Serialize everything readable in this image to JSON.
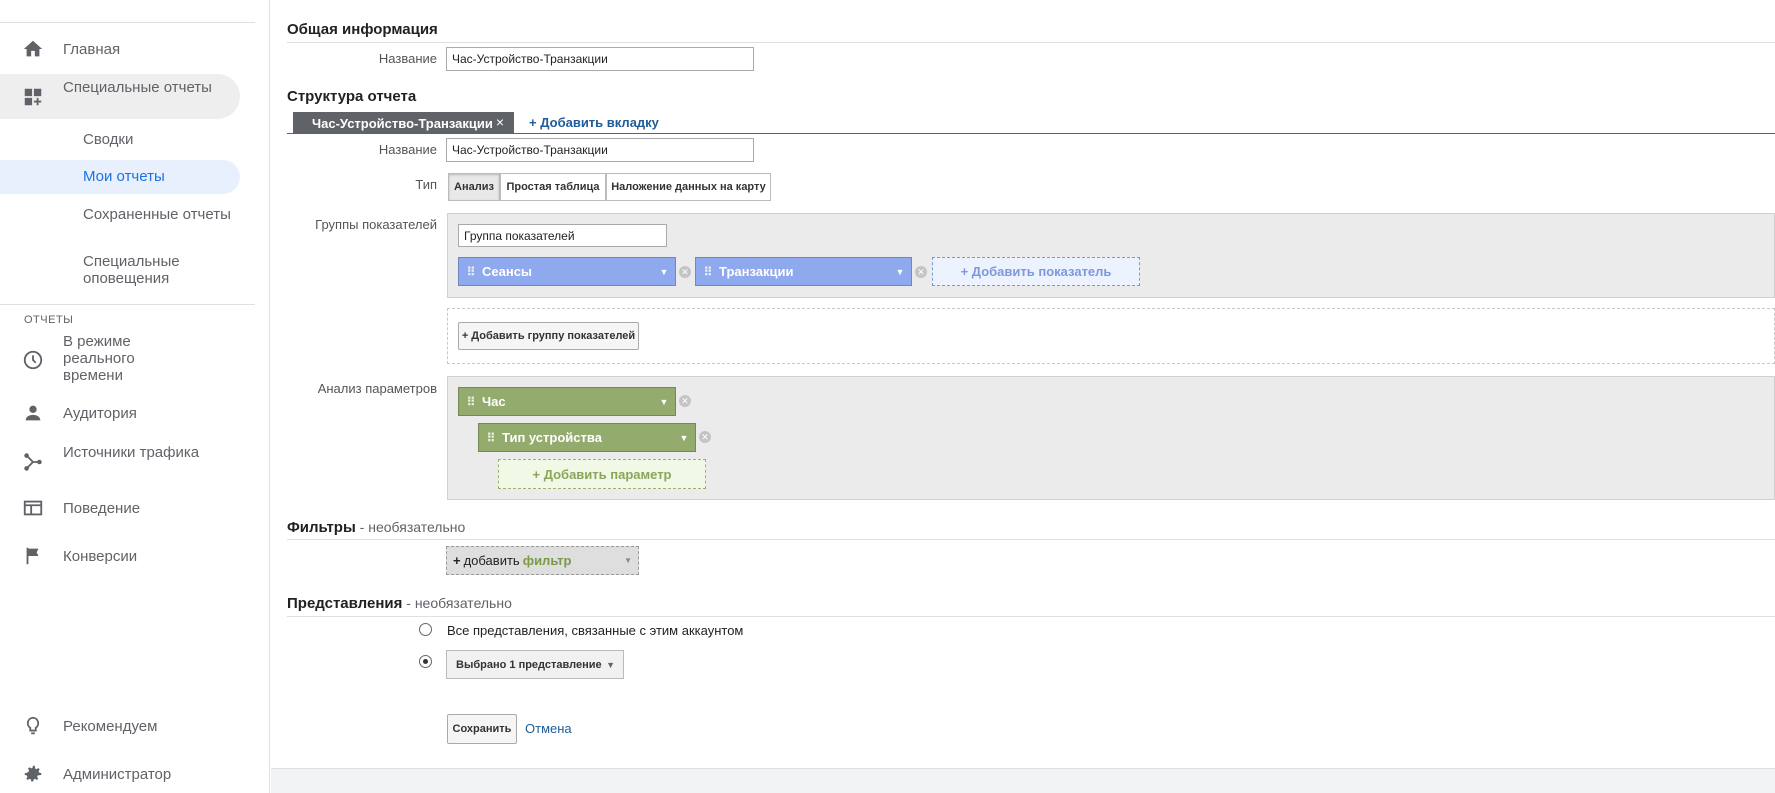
{
  "sidebar": {
    "home": "Главная",
    "custom_reports": "Специальные отчеты",
    "sub_items": [
      "Сводки",
      "Мои отчеты",
      "Сохраненные отчеты",
      "Специальные оповещения"
    ],
    "reports_section": "ОТЧЕТЫ",
    "realtime": "В режиме реального времени",
    "audience": "Аудитория",
    "acquisition": "Источники трафика",
    "behavior": "Поведение",
    "conversions": "Конверсии",
    "discover": "Рекомендуем",
    "admin": "Администратор"
  },
  "general": {
    "heading": "Общая информация",
    "name_label": "Название",
    "name_value": "Час-Устройство-Транзакции"
  },
  "structure": {
    "heading": "Структура отчета",
    "tab_label": "Час-Устройство-Транзакции",
    "tab_close": "×",
    "add_tab": "+ Добавить вкладку",
    "name_label": "Название",
    "name_value": "Час-Устройство-Транзакции",
    "type_label": "Тип",
    "types": [
      "Анализ",
      "Простая таблица",
      "Наложение данных на карту"
    ],
    "metric_groups_label": "Группы показателей",
    "metric_group_name": "Группа показателей",
    "metrics": [
      "Сеансы",
      "Транзакции"
    ],
    "add_metric": "+ Добавить показатель",
    "add_metric_group": "+ Добавить группу показателей",
    "dimension_drilldowns_label": "Анализ параметров",
    "dimensions": [
      "Час",
      "Тип устройства"
    ],
    "add_dimension": "+ Добавить параметр"
  },
  "filters": {
    "heading": "Фильтры",
    "optional": " - необязательно",
    "add_plus": "+",
    "add_word": "добавить",
    "add_filter": "фильтр"
  },
  "views": {
    "heading": "Представления",
    "optional": " - необязательно",
    "all_views": "Все представления, связанные с этим аккаунтом",
    "selected": "Выбрано 1 представление"
  },
  "actions": {
    "save": "Сохранить",
    "cancel": "Отмена"
  },
  "colors": {
    "metric_chip": "#8ea9ee",
    "dimension_chip": "#94ab6e",
    "link": "#1f5c99",
    "active_nav": "#1a73e8"
  }
}
